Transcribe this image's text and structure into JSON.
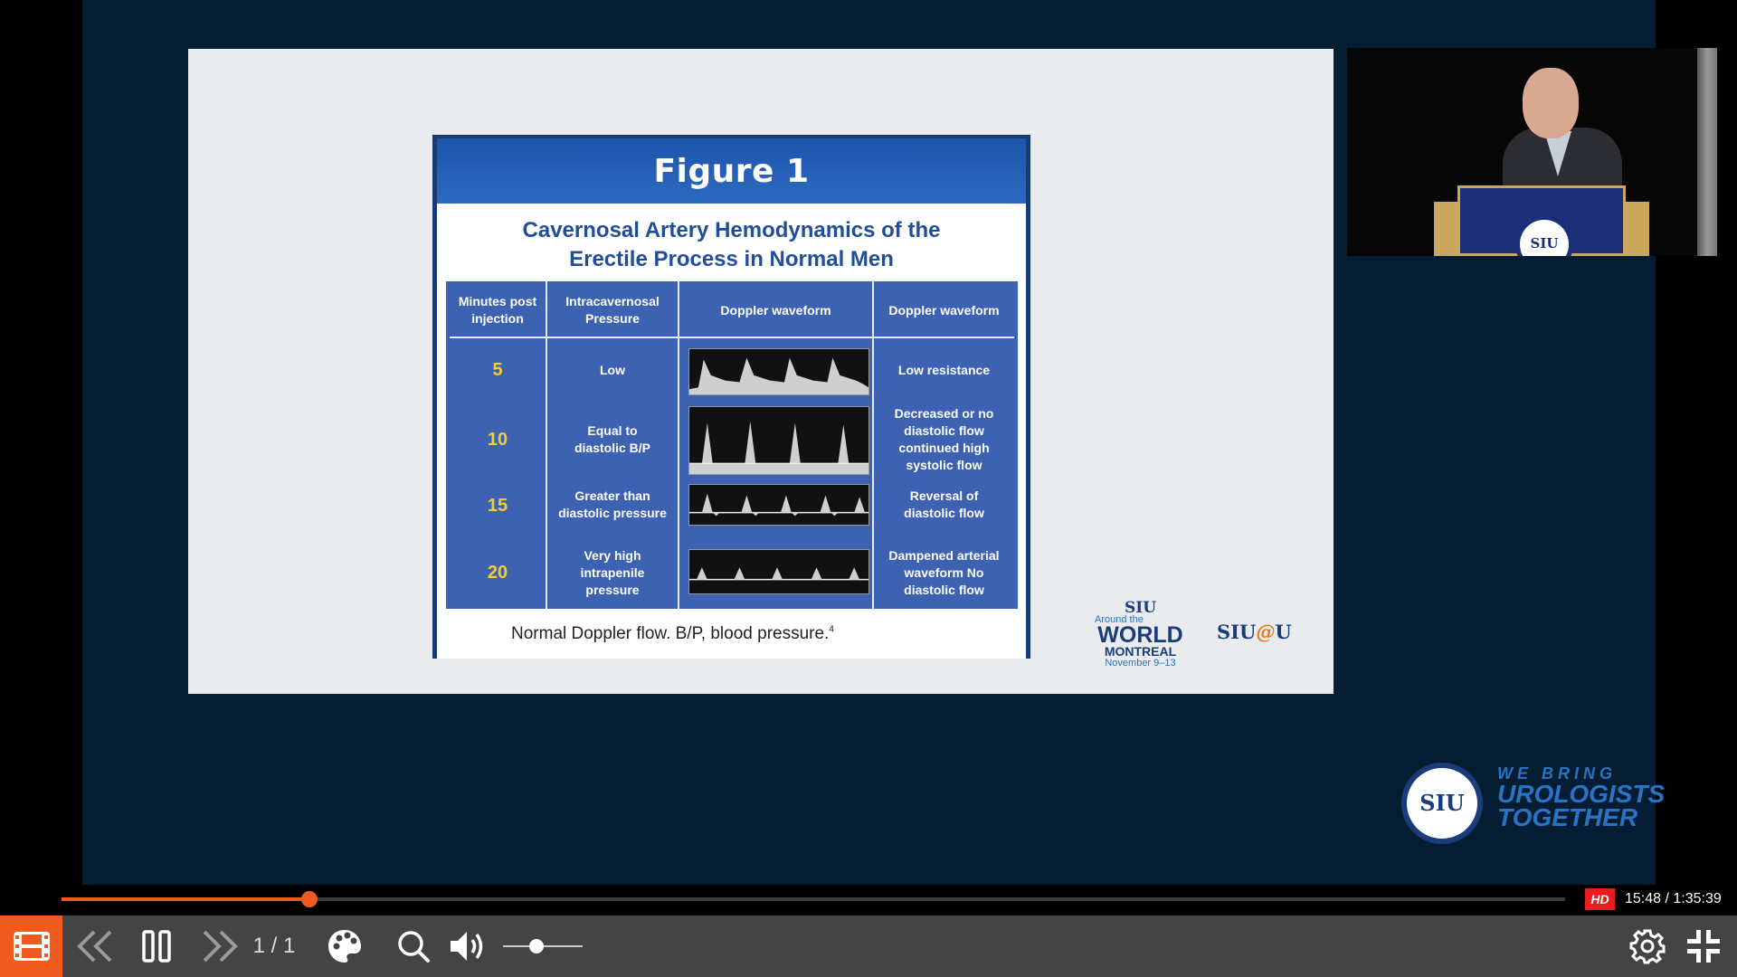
{
  "slide": {
    "figure_title": "Figure 1",
    "subtitle_line1": "Cavernosal Artery Hemodynamics of the",
    "subtitle_line2": "Erectile Process in Normal Men",
    "headers": [
      "Minutes post injection",
      "Intracavernosal Pressure",
      "Doppler waveform",
      "Doppler waveform"
    ],
    "rows": [
      {
        "minutes": "5",
        "pressure": "Low",
        "description": "Low resistance"
      },
      {
        "minutes": "10",
        "pressure": "Equal to diastolic B/P",
        "description": "Decreased or no diastolic flow continued high systolic flow"
      },
      {
        "minutes": "15",
        "pressure": "Greater than diastolic pressure",
        "description": "Reversal of diastolic flow"
      },
      {
        "minutes": "20",
        "pressure": "Very high intrapenile pressure",
        "description": "Dampened arterial waveform No diastolic flow"
      }
    ],
    "caption": "Normal Doppler flow. B/P, blood pressure.",
    "caption_ref": "4",
    "logo_world": {
      "siu": "SIU",
      "around": "Around the",
      "world": "WORLD",
      "city": "MONTREAL",
      "dates": "November 9–13"
    },
    "logo_siuu": {
      "left": "SIU",
      "at": "@",
      "right": "U"
    }
  },
  "speaker_video": {
    "podium_seal": "SIU"
  },
  "brand": {
    "seal": "SIU",
    "line1": "WE BRING",
    "line2": "UROLOGISTS",
    "line3": "TOGETHER"
  },
  "player": {
    "progress_fraction": 0.165,
    "hd_label": "HD",
    "time_display": "15:48 / 1:35:39",
    "slide_counter": "1 / 1",
    "volume_fraction": 0.42,
    "accent_color": "#ef5a1e"
  },
  "icons": [
    "film-strip-icon",
    "previous-icon",
    "pause-icon",
    "next-icon",
    "palette-icon",
    "search-icon",
    "volume-icon",
    "gear-icon",
    "exit-fullscreen-icon"
  ]
}
